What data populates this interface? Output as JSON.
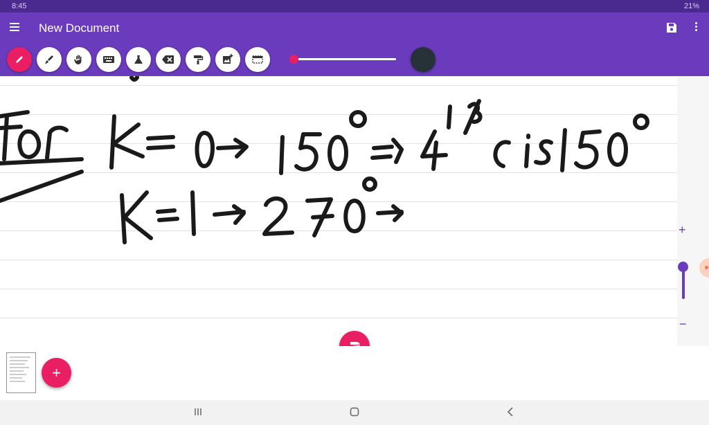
{
  "status": {
    "time": "8:45",
    "battery": "21%"
  },
  "app": {
    "title": "New Document"
  },
  "toolbar": {
    "tools": [
      {
        "icon": "pen-icon",
        "active": true
      },
      {
        "icon": "brush-icon"
      },
      {
        "icon": "hand-icon"
      },
      {
        "icon": "keyboard-icon"
      },
      {
        "icon": "flask-icon"
      },
      {
        "icon": "eraser-icon"
      },
      {
        "icon": "paint-roller-icon"
      },
      {
        "icon": "add-image-icon"
      },
      {
        "icon": "selection-icon"
      }
    ],
    "pen_size_level": 0.0,
    "pen_color": "#263238",
    "accent_color": "#e91e63",
    "brand_color": "#6a3bbd"
  },
  "canvas": {
    "ink_lines": [
      "For K=0→150° ⇒ 4^(1/3) cis150°",
      "K=1→270°→"
    ]
  },
  "zoom": {
    "plus": "+",
    "minus": "−"
  },
  "pages": {
    "add_label": "+"
  }
}
